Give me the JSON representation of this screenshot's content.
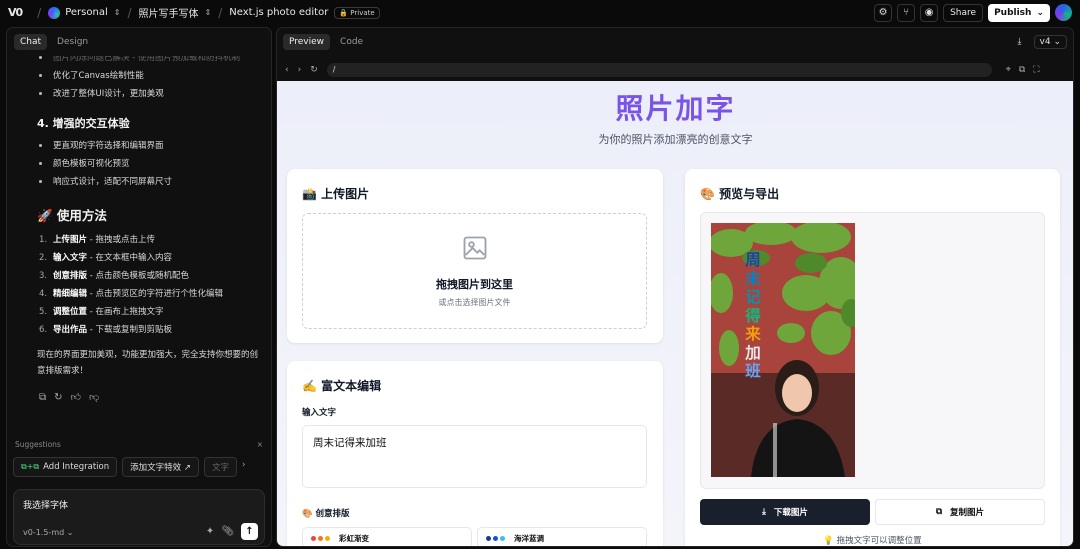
{
  "topbar": {
    "logo": "V0",
    "workspace": "Personal",
    "project": "照片写手写体",
    "chat_title": "Next.js photo editor",
    "visibility": "Private",
    "share_label": "Share",
    "publish_label": "Publish"
  },
  "chat": {
    "tabs": [
      "Chat",
      "Design"
    ],
    "faded_item": "图片闪烁问题已解决 - 使用图片预加载和防抖机制",
    "list1": [
      "优化了Canvas绘制性能",
      "改进了整体UI设计，更加美观"
    ],
    "section4_title": "4. 增强的交互体验",
    "list2": [
      "更直观的字符选择和编辑界面",
      "颜色模板可视化预览",
      "响应式设计，适配不同屏幕尺寸"
    ],
    "usage_title": "🚀 使用方法",
    "steps": [
      {
        "n": "1.",
        "bold": "上传图片",
        "rest": " - 拖拽或点击上传"
      },
      {
        "n": "2.",
        "bold": "输入文字",
        "rest": " - 在文本框中输入内容"
      },
      {
        "n": "3.",
        "bold": "创意排版",
        "rest": " - 点击颜色模板或随机配色"
      },
      {
        "n": "4.",
        "bold": "精细编辑",
        "rest": " - 点击预览区的字符进行个性化编辑"
      },
      {
        "n": "5.",
        "bold": "调整位置",
        "rest": " - 在画布上拖拽文字"
      },
      {
        "n": "6.",
        "bold": "导出作品",
        "rest": " - 下载或复制到剪贴板"
      }
    ],
    "closing": "现在的界面更加美观，功能更加强大，完全支持你想要的创意排版需求！",
    "suggestions_label": "Suggestions",
    "suggestion_chips": [
      "Add Integration",
      "添加文字特效 ↗",
      "文字"
    ],
    "input_value": "我选择字体",
    "model": "v0-1.5-md"
  },
  "preview": {
    "tabs": [
      "Preview",
      "Code"
    ],
    "version": "v4",
    "url": "/"
  },
  "site": {
    "title": "照片加字",
    "subtitle": "为你的照片添加漂亮的创意文字",
    "upload": {
      "title": "📸 上传图片",
      "drop_title": "拖拽图片到这里",
      "drop_sub": "或点击选择图片文件"
    },
    "editor": {
      "title": "✍️ 富文本编辑",
      "input_label": "输入文字",
      "input_value": "周末记得来加班",
      "layout_label": "🎨 创意排版",
      "templates": [
        "彩虹渐变",
        "海洋蓝调"
      ]
    },
    "export": {
      "title": "🎨 预览与导出",
      "overlay_chars": [
        "周",
        "末",
        "记",
        "得",
        "来",
        "加",
        "班"
      ],
      "overlay_colors": [
        "#1e40af",
        "#0284c7",
        "#0891b2",
        "#10b981",
        "#f59e0b",
        "#e5e7eb",
        "#60a5fa"
      ],
      "download_label": "下载图片",
      "copy_label": "复制图片",
      "hint": "💡 拖拽文字可以调整位置"
    }
  }
}
